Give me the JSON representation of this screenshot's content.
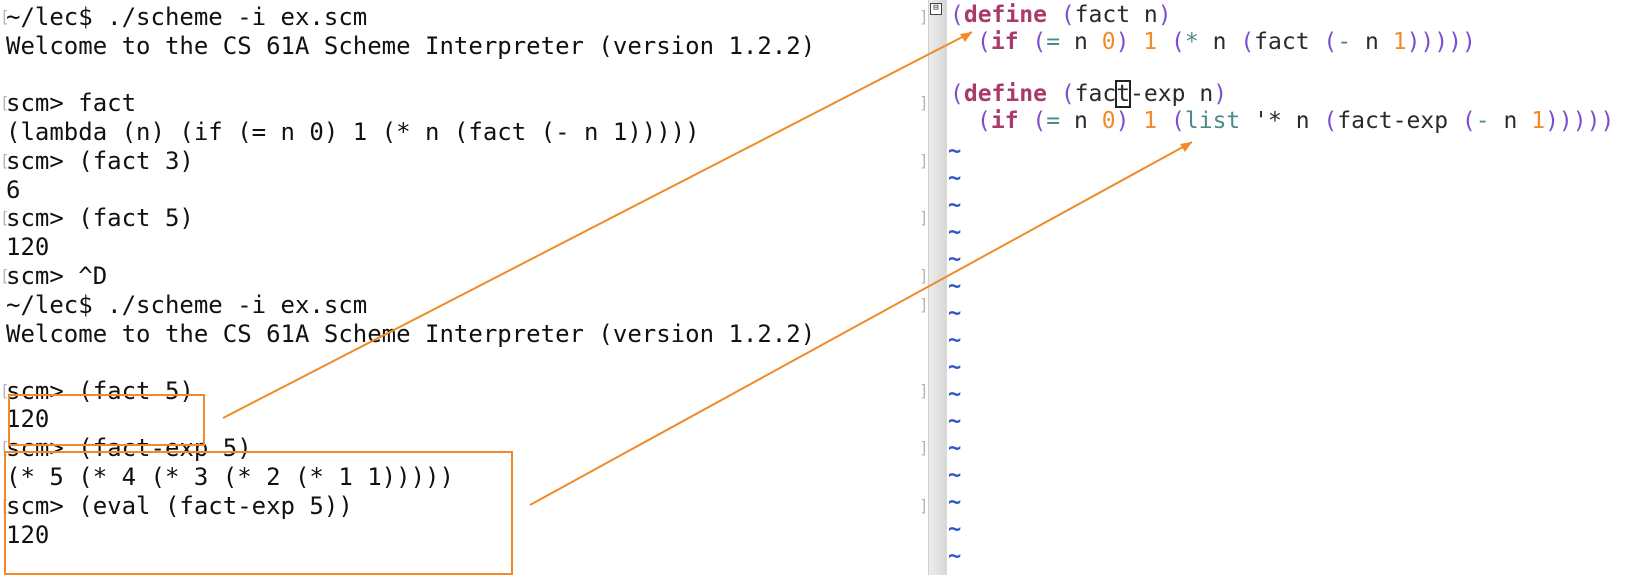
{
  "terminal": {
    "lines": [
      "~/lec$ ./scheme -i ex.scm",
      "Welcome to the CS 61A Scheme Interpreter (version 1.2.2)",
      "",
      "scm> fact",
      "(lambda (n) (if (= n 0) 1 (* n (fact (- n 1)))))",
      "scm> (fact 3)",
      "6",
      "scm> (fact 5)",
      "120",
      "scm> ^D",
      "~/lec$ ./scheme -i ex.scm",
      "Welcome to the CS 61A Scheme Interpreter (version 1.2.2)",
      "",
      "scm> (fact 5)",
      "120",
      "scm> (fact-exp 5)",
      "(* 5 (* 4 (* 3 (* 2 (* 1 1)))))",
      "scm> (eval (fact-exp 5))",
      "120"
    ]
  },
  "editor": {
    "fold_icon": "⊟",
    "tilde": "~",
    "code": {
      "define": "define",
      "if": "if",
      "list": "list",
      "fact_name": "fact",
      "fact_exp_pre": "fac",
      "fact_exp_cursor": "t",
      "fact_exp_post": "-exp",
      "param": "n",
      "eq": "=",
      "zero": "0",
      "one": "1",
      "star": "*",
      "quote_star": "'*",
      "minus": "-"
    }
  },
  "colors": {
    "keyword": "#a83b69",
    "paren": "#7a4fd0",
    "number": "#f08a2a",
    "builtin": "#4c8c88",
    "tilde": "#2f55c8",
    "annotation": "#f08a2a"
  },
  "annotations": {
    "connectors": [
      "fact-5-to-fact-definition",
      "fact-exp-to-list-call"
    ]
  }
}
